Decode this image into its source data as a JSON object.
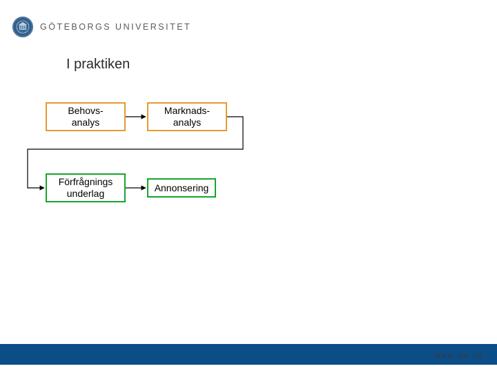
{
  "brand": {
    "wordmark": "GÖTEBORGS UNIVERSITET"
  },
  "title": "I praktiken",
  "boxes": {
    "behovs": {
      "line1": "Behovs-",
      "line2": "analys"
    },
    "marknads": {
      "line1": "Marknads-",
      "line2": "analys"
    },
    "forfrag": {
      "line1": "Förfrågnings",
      "line2": "underlag"
    },
    "annonsering": {
      "line1": "Annonsering"
    }
  },
  "footer": {
    "url": "www. gu. se"
  },
  "colors": {
    "orange": "#e59a2e",
    "green": "#17a42c",
    "brand": "#0b4e87"
  }
}
